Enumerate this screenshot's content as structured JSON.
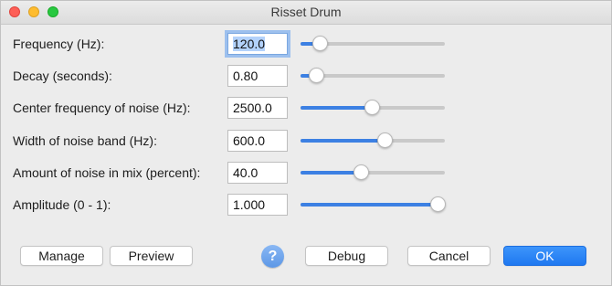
{
  "window": {
    "title": "Risset Drum"
  },
  "params": [
    {
      "label": "Frequency (Hz):",
      "value": "120.0",
      "level": 0.09,
      "focused": true
    },
    {
      "label": "Decay (seconds):",
      "value": "0.80",
      "level": 0.06,
      "focused": false
    },
    {
      "label": "Center frequency of noise (Hz):",
      "value": "2500.0",
      "level": 0.49,
      "focused": false
    },
    {
      "label": "Width of noise band (Hz):",
      "value": "600.0",
      "level": 0.59,
      "focused": false
    },
    {
      "label": "Amount of noise in mix (percent):",
      "value": "40.0",
      "level": 0.41,
      "focused": false
    },
    {
      "label": "Amplitude (0 - 1):",
      "value": "1.000",
      "level": 1.0,
      "focused": false
    }
  ],
  "buttons": {
    "manage": "Manage",
    "preview": "Preview",
    "help": "?",
    "debug": "Debug",
    "cancel": "Cancel",
    "ok": "OK"
  },
  "colors": {
    "accent": "#3c80e3",
    "ok_button": "#2a86f8",
    "help_icon": "#6fa4ec"
  }
}
